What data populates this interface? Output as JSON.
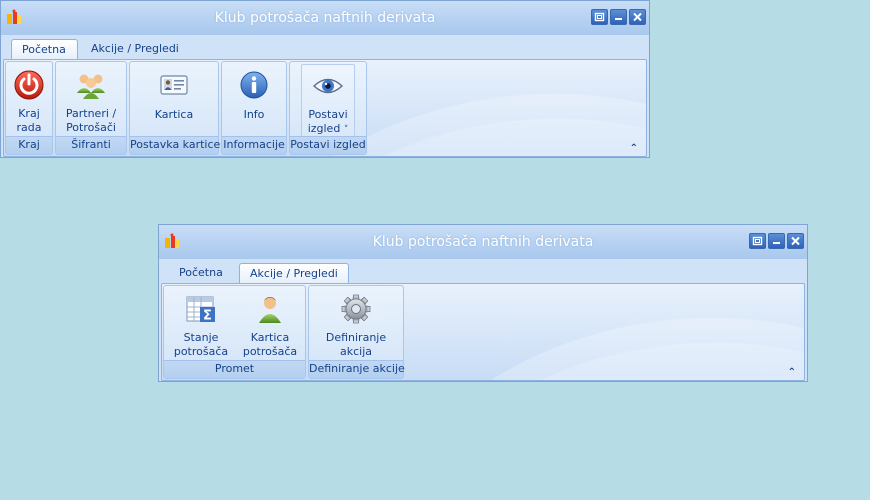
{
  "windows": [
    {
      "title": "Klub potrošača naftnih derivata",
      "tabs": [
        "Početna",
        "Akcije / Pregledi"
      ],
      "active_tab": 0,
      "groups": [
        {
          "label": "Kraj",
          "buttons": [
            {
              "line1": "Kraj",
              "line2": "rada",
              "icon": "power-icon"
            }
          ]
        },
        {
          "label": "Šifranti",
          "buttons": [
            {
              "line1": "Partneri /",
              "line2": "Potrošači",
              "icon": "users-icon"
            }
          ]
        },
        {
          "label": "Postavka kartice",
          "buttons": [
            {
              "line1": "Kartica",
              "line2": "",
              "icon": "id-card-icon"
            }
          ]
        },
        {
          "label": "Informacije",
          "buttons": [
            {
              "line1": "Info",
              "line2": "",
              "icon": "info-icon"
            }
          ]
        },
        {
          "label": "Postavi izgled",
          "buttons": [
            {
              "line1": "Postavi",
              "line2": "izgled",
              "dropdown": "˅",
              "icon": "eye-icon"
            }
          ]
        }
      ],
      "collapse_glyph": "⌃"
    },
    {
      "title": "Klub potrošača naftnih derivata",
      "tabs": [
        "Početna",
        "Akcije / Pregledi"
      ],
      "active_tab": 1,
      "groups": [
        {
          "label": "Promet",
          "buttons": [
            {
              "line1": "Stanje",
              "line2": "potrošača",
              "icon": "table-sum-icon"
            },
            {
              "line1": "Kartica",
              "line2": "potrošača",
              "icon": "user-icon"
            }
          ]
        },
        {
          "label": "Definiranje akcije",
          "buttons": [
            {
              "line1": "Definiranje",
              "line2": "akcija",
              "icon": "gear-icon"
            }
          ]
        }
      ],
      "collapse_glyph": "⌃"
    }
  ],
  "colors": {
    "background": "#b6dde6",
    "text": "#15428b",
    "ribbon": "#d5e5f8",
    "accent": "#2d62b8"
  }
}
